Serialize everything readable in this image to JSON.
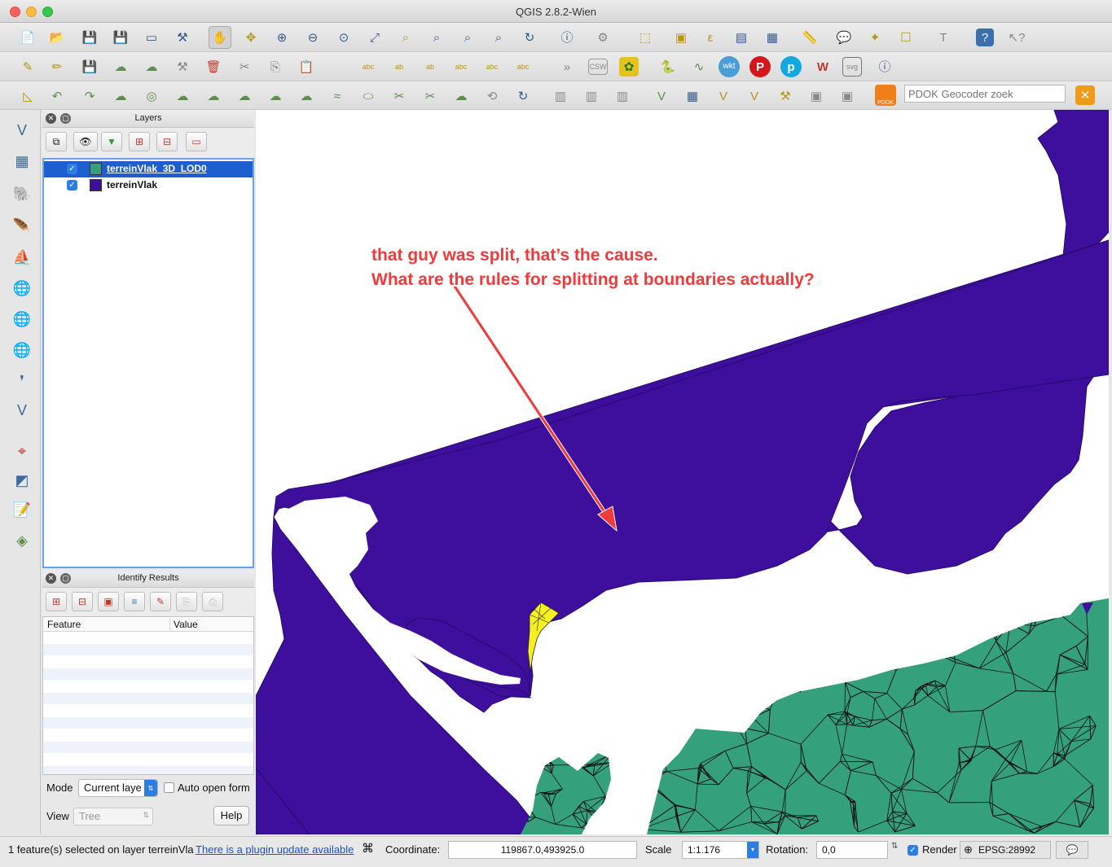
{
  "window": {
    "title": "QGIS 2.8.2-Wien"
  },
  "toolbar1": {
    "icons": [
      "new-project-icon",
      "open-project-icon",
      "save-project-icon",
      "save-as-icon",
      "new-print-composer-icon",
      "composer-manager-icon",
      "pan-hand-icon",
      "pan-to-selection-icon",
      "zoom-in-icon",
      "zoom-out-icon",
      "zoom-actual-icon",
      "zoom-full-icon",
      "zoom-to-selection-icon",
      "zoom-to-layer-icon",
      "zoom-last-icon",
      "zoom-next-icon",
      "refresh-icon",
      "identify-icon",
      "action-icon",
      "select-icon",
      "deselect-icon",
      "expression-icon",
      "attribute-table-icon",
      "field-calculator-icon",
      "measure-icon",
      "map-tips-icon",
      "new-bookmark-icon",
      "show-bookmarks-icon",
      "text-annotation-icon",
      "help-icon",
      "whats-this-icon"
    ]
  },
  "toolbar2": {
    "icons": [
      "edit-pencil-icon",
      "toggle-editing-icon",
      "save-edits-icon",
      "add-feature-icon",
      "move-feature-icon",
      "node-tool-icon",
      "delete-selected-icon",
      "cut-icon",
      "copy-icon",
      "paste-icon",
      "label-icon",
      "pin-label-icon",
      "show-hide-label-icon",
      "move-label-icon",
      "rotate-label-icon",
      "change-label-icon",
      "more-icon",
      "csw-icon",
      "plugin-green-icon",
      "python-icon",
      "processing-icon",
      "wkt-icon",
      "p-red-icon",
      "p-blue-icon",
      "wkt-text-icon",
      "svg-icon",
      "info-icon"
    ]
  },
  "toolbar2_labels": {
    "csw": "CSW",
    "wkt": "wkt",
    "svg": "svg"
  },
  "toolbar3": {
    "icons": [
      "snapping-icon",
      "undo-icon",
      "redo-icon",
      "simplify-icon",
      "add-ring-icon",
      "add-part-icon",
      "fill-ring-icon",
      "delete-ring-icon",
      "delete-part-icon",
      "reshape-icon",
      "offset-curve-icon",
      "split-features-icon",
      "split-parts-icon",
      "merge-features-icon",
      "merge-attributes-icon",
      "rotate-point-icon",
      "rotate-feature-icon",
      "add-delimited-layer-icon",
      "add-vector-icon",
      "remove-layer-icon",
      "add-spatialite-icon",
      "add-postgis-icon",
      "capture-line-icon",
      "capture-polygon-icon",
      "digitize-icon",
      "georef-icon",
      "db-manager-icon",
      "pdok-icon"
    ]
  },
  "geocoder": {
    "placeholder": "PDOK Geocoder zoek",
    "pdok_label": "PDOK"
  },
  "left_tools": {
    "icons": [
      "add-vector-layer-icon",
      "add-raster-layer-icon",
      "add-postgis-layer-icon",
      "add-spatialite-layer-icon",
      "add-mssql-layer-icon",
      "add-wms-layer-icon",
      "add-wcs-layer-icon",
      "add-wfs-layer-icon",
      "add-delimited-text-layer-icon",
      "new-shapefile-icon",
      "georeferencer-icon",
      "digitizing-icon",
      "gps-icon",
      "grass-icon"
    ]
  },
  "layers_panel": {
    "title": "Layers",
    "layers": [
      {
        "name": "terreinVlak_3D_LOD0",
        "color": "#35a07c",
        "checked": true,
        "selected": true
      },
      {
        "name": "terreinVlak",
        "color": "#3d0f9c",
        "checked": true,
        "selected": false
      }
    ]
  },
  "identify_panel": {
    "title": "Identify Results",
    "columns": [
      "Feature",
      "Value"
    ],
    "mode_label": "Mode",
    "mode_value": "Current laye",
    "auto_open_label": "Auto open form",
    "view_label": "View",
    "view_value": "Tree",
    "help_label": "Help"
  },
  "map": {
    "annotation": {
      "line1": "that guy was split, that’s the cause.",
      "line2": "What are the rules for splitting at boundaries actually?"
    },
    "colors": {
      "purple": "#3d0f9c",
      "green": "#35a07c",
      "yellow": "#f6f020",
      "arrow": "#ee3b3b"
    }
  },
  "statusbar": {
    "message": "1 feature(s) selected on layer terreinVla",
    "plugin_link": "There is a plugin update available",
    "coordinate_label": "Coordinate:",
    "coordinate_value": "119867.0,493925.0",
    "scale_label": "Scale",
    "scale_value": "1:1.176",
    "rotation_label": "Rotation:",
    "rotation_value": "0,0",
    "render_label": "Render",
    "crs": "EPSG:28992"
  }
}
